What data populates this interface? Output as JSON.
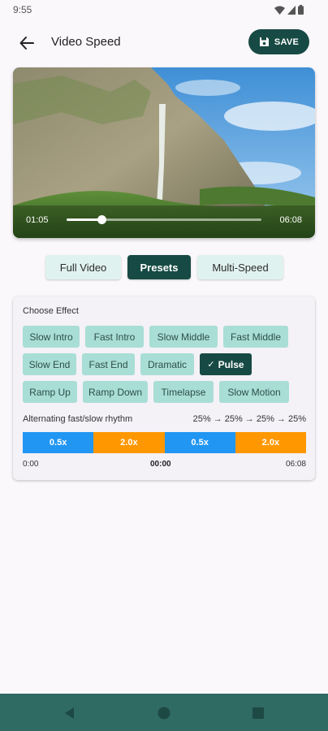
{
  "status_bar": {
    "time": "9:55",
    "icons": [
      "wifi-icon",
      "cell-signal-icon",
      "battery-icon"
    ]
  },
  "header": {
    "title": "Video Speed",
    "save_label": "SAVE",
    "back_icon": "arrow-back-icon",
    "save_icon": "floppy-disk-icon"
  },
  "video": {
    "current_time": "01:05",
    "duration": "06:08",
    "progress": 0.18
  },
  "mode_tabs": [
    {
      "label": "Full Video",
      "active": false
    },
    {
      "label": "Presets",
      "active": true
    },
    {
      "label": "Multi-Speed",
      "active": false
    }
  ],
  "effects": {
    "heading": "Choose Effect",
    "options": [
      "Slow Intro",
      "Fast Intro",
      "Slow Middle",
      "Fast Middle",
      "Slow End",
      "Fast End",
      "Dramatic",
      "Pulse",
      "Ramp Up",
      "Ramp Down",
      "Timelapse",
      "Slow Motion"
    ],
    "selected": "Pulse",
    "description": "Alternating fast/slow rhythm",
    "distribution": "25% → 25% → 25% → 25%",
    "segments": [
      {
        "label": "0.5x",
        "color": "#2196f3",
        "share": 0.25
      },
      {
        "label": "2.0x",
        "color": "#ff9800",
        "share": 0.25
      },
      {
        "label": "0.5x",
        "color": "#2196f3",
        "share": 0.25
      },
      {
        "label": "2.0x",
        "color": "#ff9800",
        "share": 0.25
      }
    ],
    "timeline_start": "0:00",
    "timeline_current": "00:00",
    "timeline_end": "06:08"
  },
  "colors": {
    "primary": "#174a44",
    "chip": "#a9ded6",
    "nav_bar": "#2f6a63"
  },
  "nav": [
    "back-triangle-icon",
    "home-circle-icon",
    "recents-square-icon"
  ]
}
